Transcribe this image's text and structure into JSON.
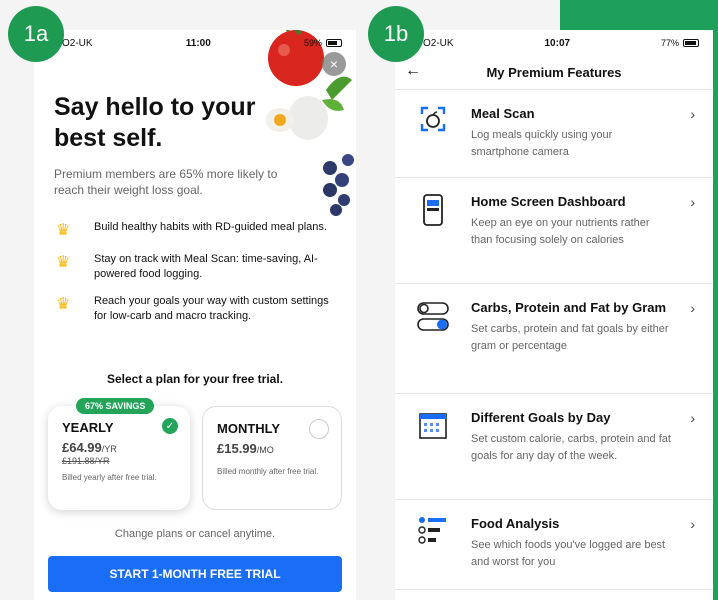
{
  "labels": {
    "left": "1a",
    "right": "1b"
  },
  "left_phone": {
    "status": {
      "carrier": "O2-UK",
      "time": "11:00",
      "battery": "59%"
    },
    "close_label": "×",
    "hero_title": "Say hello to your best self.",
    "hero_subtitle": "Premium members are 65% more likely to reach their weight loss goal.",
    "bullets": [
      "Build healthy habits with RD-guided meal plans.",
      "Stay on track with Meal Scan: time-saving, AI-powered food logging.",
      "Reach your goals your way with custom settings for low-carb and macro tracking."
    ],
    "select_title": "Select a plan for your free trial.",
    "plans": {
      "yearly": {
        "badge": "67% SAVINGS",
        "name": "YEARLY",
        "price": "£64.99",
        "per": "/YR",
        "old_price": "£191.88/YR",
        "note": "Billed yearly after free trial."
      },
      "monthly": {
        "name": "MONTHLY",
        "price": "£15.99",
        "per": "/MO",
        "note": "Billed monthly after free trial."
      }
    },
    "change_text": "Change plans or cancel anytime.",
    "cta": "START 1-MONTH FREE TRIAL"
  },
  "right_phone": {
    "status": {
      "carrier": "O2-UK",
      "time": "10:07",
      "battery": "77%"
    },
    "title": "My Premium Features",
    "features": [
      {
        "title": "Meal Scan",
        "desc": "Log meals quickly using your smartphone camera",
        "icon": "camera-scan-icon"
      },
      {
        "title": "Home Screen Dashboard",
        "desc": "Keep an eye on your nutrients rather than focusing solely on calories",
        "icon": "phone-dashboard-icon"
      },
      {
        "title": "Carbs, Protein and Fat by Gram",
        "desc": "Set carbs, protein and fat goals by either gram or percentage",
        "icon": "toggle-icon"
      },
      {
        "title": "Different Goals by Day",
        "desc": "Set custom calorie, carbs, protein and fat goals for any day of the week.",
        "icon": "calendar-icon"
      },
      {
        "title": "Food Analysis",
        "desc": "See which foods you've logged are best and worst for you",
        "icon": "list-analysis-icon"
      }
    ]
  },
  "colors": {
    "accent_green": "#23a559",
    "cta_blue": "#1a6ef5",
    "crown": "#f6b800"
  }
}
